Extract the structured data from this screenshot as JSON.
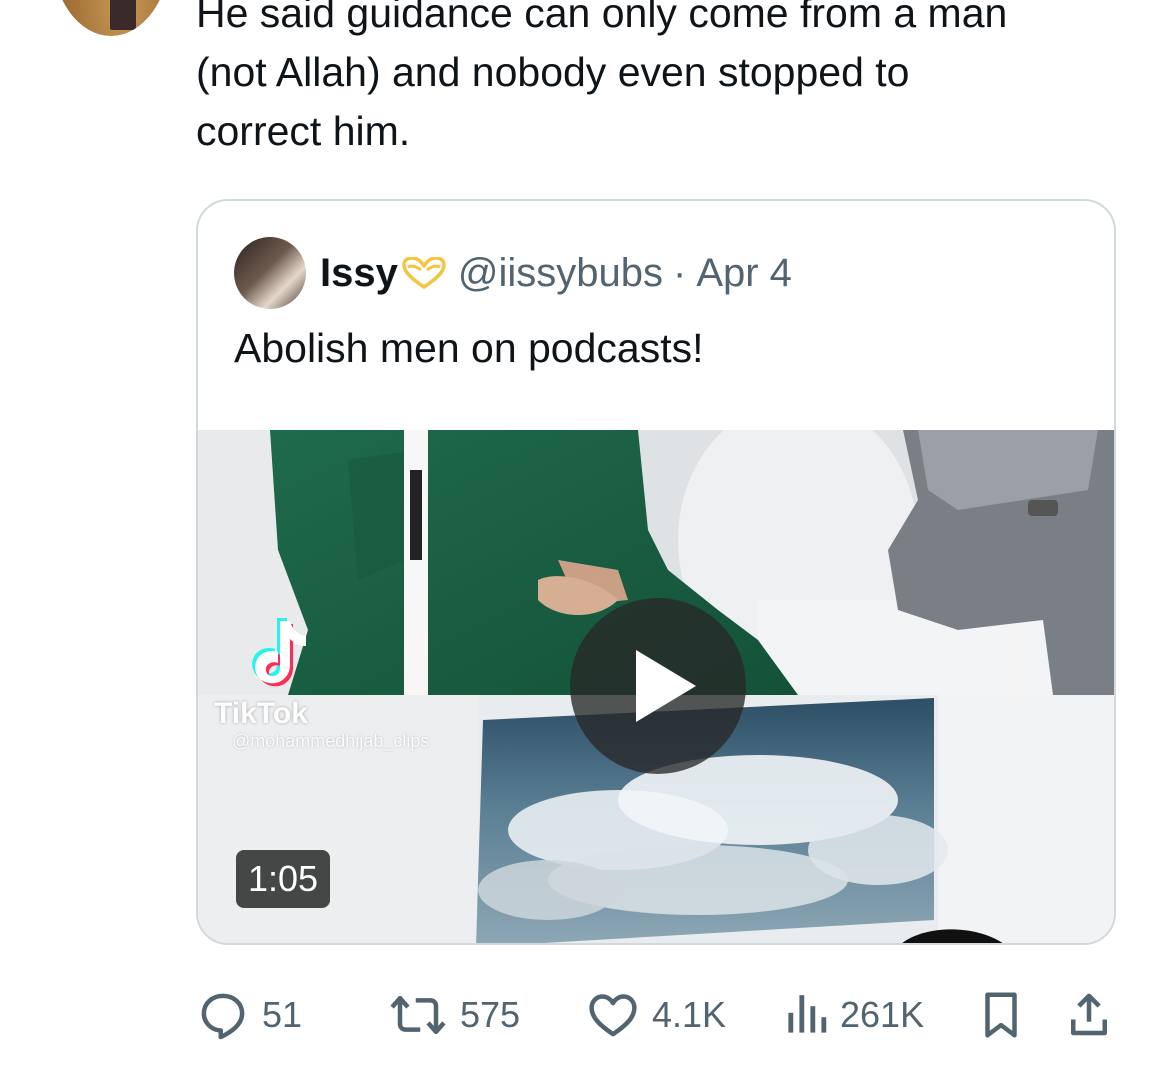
{
  "tweet": {
    "text": "He said guidance can only come from a man\n(not Allah) and nobody even stopped to\ncorrect him."
  },
  "quote": {
    "name": "Issy",
    "handle": "@iissybubs",
    "separator": "·",
    "date": "Apr 4",
    "text": "Abolish men on podcasts!",
    "heart_icon": "yellow-heart-hands-icon",
    "heart_color": "#f5c542"
  },
  "media": {
    "duration": "1:05",
    "watermark_brand": "TikTok",
    "watermark_user": "@mohammedhijab_clips"
  },
  "actions": {
    "replies": "51",
    "reposts": "575",
    "likes": "4.1K",
    "views": "261K"
  },
  "colors": {
    "text": "#0f1419",
    "muted": "#536471",
    "border": "#cfd9de"
  }
}
